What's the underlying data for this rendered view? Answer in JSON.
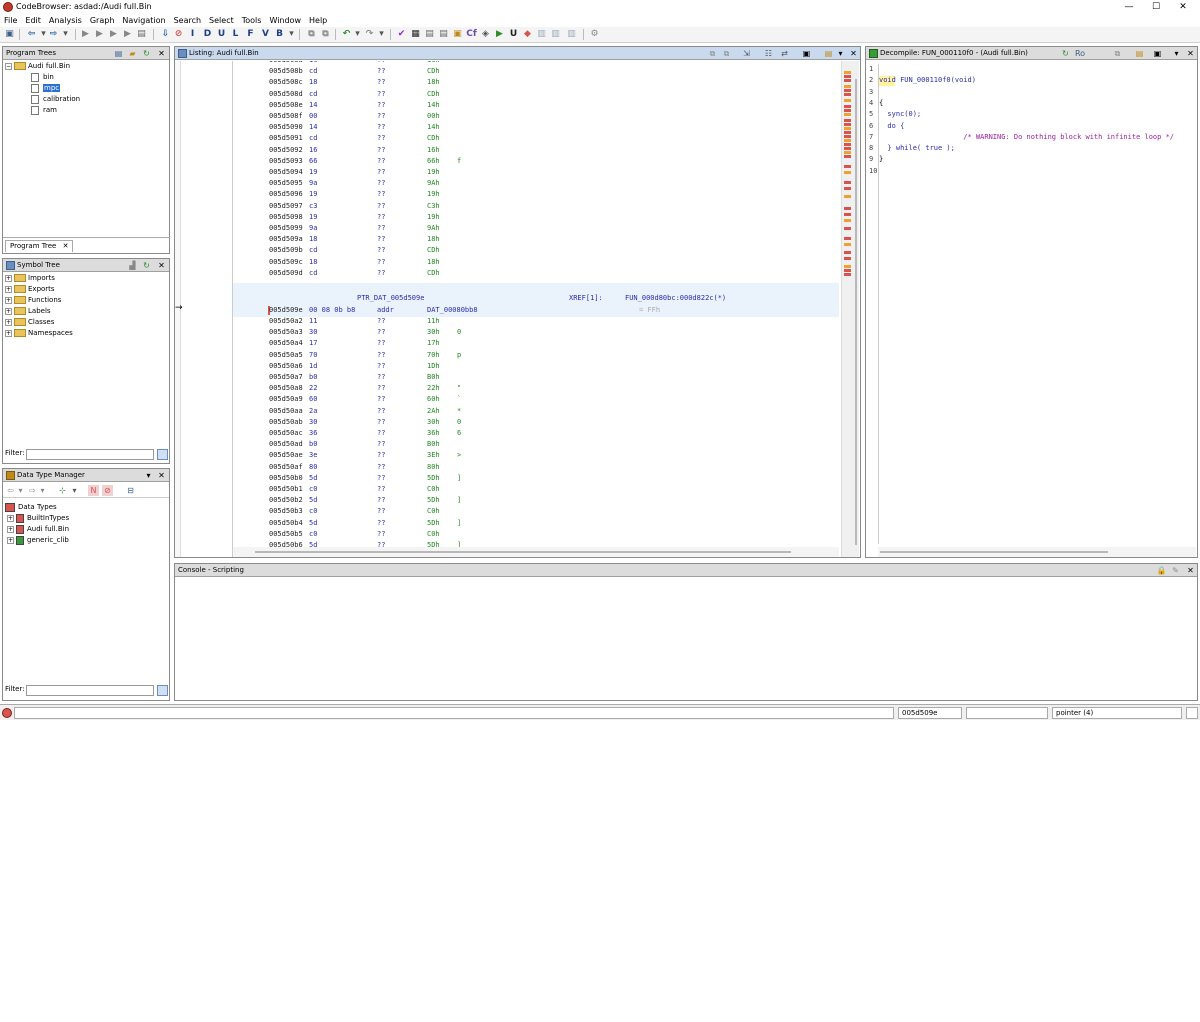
{
  "window": {
    "title": "CodeBrowser: asdad:/Audi full.Bin",
    "minimize": "—",
    "maximize": "☐",
    "close": "✕"
  },
  "menu": [
    "File",
    "Edit",
    "Analysis",
    "Graph",
    "Navigation",
    "Search",
    "Select",
    "Tools",
    "Window",
    "Help"
  ],
  "toolbar_icons": [
    "save-icon",
    "back-icon",
    "forward-icon",
    "nav-data-icon",
    "nav-undefined-icon",
    "nav-label-icon",
    "nav-function-icon",
    "nav-instruction-icon",
    "down-arrow-icon",
    "stop-icon",
    "I",
    "D",
    "U",
    "L",
    "F",
    "V",
    "B",
    "undo-icon",
    "redo-icon",
    "check-icon",
    "hex-icon",
    "clear-icon",
    "camera-icon",
    "cf-icon",
    "play-icon",
    "U2",
    "bookmark-icon",
    "memory-icon",
    "bytes-icon",
    "window-icon",
    "help-icon"
  ],
  "program_trees": {
    "title": "Program Trees",
    "root": "Audi full.Bin",
    "items": [
      "bin",
      "mpc",
      "calibration",
      "ram"
    ],
    "selected": "mpc",
    "tab": "Program Tree",
    "tab_close": "✕"
  },
  "symbol_tree": {
    "title": "Symbol Tree",
    "items": [
      "Imports",
      "Exports",
      "Functions",
      "Labels",
      "Classes",
      "Namespaces"
    ],
    "filter_label": "Filter:"
  },
  "data_type_manager": {
    "title": "Data Type Manager",
    "root": "Data Types",
    "items": [
      "BuiltInTypes",
      "Audi full.Bin",
      "generic_clib"
    ],
    "filter_label": "Filter:"
  },
  "listing": {
    "title": "Listing:  Audi full.Bin",
    "rows_top": [
      {
        "addr": "005d508a",
        "byte": "1c",
        "mnem": "??",
        "oper": "1Ch",
        "chr": ""
      },
      {
        "addr": "005d508b",
        "byte": "cd",
        "mnem": "??",
        "oper": "CDh",
        "chr": ""
      },
      {
        "addr": "005d508c",
        "byte": "18",
        "mnem": "??",
        "oper": "18h",
        "chr": ""
      },
      {
        "addr": "005d508d",
        "byte": "cd",
        "mnem": "??",
        "oper": "CDh",
        "chr": ""
      },
      {
        "addr": "005d508e",
        "byte": "14",
        "mnem": "??",
        "oper": "14h",
        "chr": ""
      },
      {
        "addr": "005d508f",
        "byte": "00",
        "mnem": "??",
        "oper": "00h",
        "chr": ""
      },
      {
        "addr": "005d5090",
        "byte": "14",
        "mnem": "??",
        "oper": "14h",
        "chr": ""
      },
      {
        "addr": "005d5091",
        "byte": "cd",
        "mnem": "??",
        "oper": "CDh",
        "chr": ""
      },
      {
        "addr": "005d5092",
        "byte": "16",
        "mnem": "??",
        "oper": "16h",
        "chr": ""
      },
      {
        "addr": "005d5093",
        "byte": "66",
        "mnem": "??",
        "oper": "66h",
        "chr": "f"
      },
      {
        "addr": "005d5094",
        "byte": "19",
        "mnem": "??",
        "oper": "19h",
        "chr": ""
      },
      {
        "addr": "005d5095",
        "byte": "9a",
        "mnem": "??",
        "oper": "9Ah",
        "chr": ""
      },
      {
        "addr": "005d5096",
        "byte": "19",
        "mnem": "??",
        "oper": "19h",
        "chr": ""
      },
      {
        "addr": "005d5097",
        "byte": "c3",
        "mnem": "??",
        "oper": "C3h",
        "chr": ""
      },
      {
        "addr": "005d5098",
        "byte": "19",
        "mnem": "??",
        "oper": "19h",
        "chr": ""
      },
      {
        "addr": "005d5099",
        "byte": "9a",
        "mnem": "??",
        "oper": "9Ah",
        "chr": ""
      },
      {
        "addr": "005d509a",
        "byte": "18",
        "mnem": "??",
        "oper": "18h",
        "chr": ""
      },
      {
        "addr": "005d509b",
        "byte": "cd",
        "mnem": "??",
        "oper": "CDh",
        "chr": ""
      },
      {
        "addr": "005d509c",
        "byte": "18",
        "mnem": "??",
        "oper": "18h",
        "chr": ""
      },
      {
        "addr": "005d509d",
        "byte": "cd",
        "mnem": "??",
        "oper": "CDh",
        "chr": ""
      }
    ],
    "label": "PTR_DAT_005d509e",
    "xref": "XREF[1]:",
    "xref_target": "FUN_000d80bc:000d822c(*)",
    "ptr_row": {
      "addr": "005d509e",
      "bytes": "00 08 0b b8",
      "mnem": "addr",
      "oper": "DAT_00080bb8",
      "comment": "= FFh"
    },
    "rows_bottom": [
      {
        "addr": "005d50a2",
        "byte": "11",
        "mnem": "??",
        "oper": "11h",
        "chr": ""
      },
      {
        "addr": "005d50a3",
        "byte": "30",
        "mnem": "??",
        "oper": "30h",
        "chr": "0"
      },
      {
        "addr": "005d50a4",
        "byte": "17",
        "mnem": "??",
        "oper": "17h",
        "chr": ""
      },
      {
        "addr": "005d50a5",
        "byte": "70",
        "mnem": "??",
        "oper": "70h",
        "chr": "p"
      },
      {
        "addr": "005d50a6",
        "byte": "1d",
        "mnem": "??",
        "oper": "1Dh",
        "chr": ""
      },
      {
        "addr": "005d50a7",
        "byte": "b0",
        "mnem": "??",
        "oper": "B0h",
        "chr": ""
      },
      {
        "addr": "005d50a8",
        "byte": "22",
        "mnem": "??",
        "oper": "22h",
        "chr": "\""
      },
      {
        "addr": "005d50a9",
        "byte": "60",
        "mnem": "??",
        "oper": "60h",
        "chr": "`"
      },
      {
        "addr": "005d50aa",
        "byte": "2a",
        "mnem": "??",
        "oper": "2Ah",
        "chr": "*"
      },
      {
        "addr": "005d50ab",
        "byte": "30",
        "mnem": "??",
        "oper": "30h",
        "chr": "0"
      },
      {
        "addr": "005d50ac",
        "byte": "36",
        "mnem": "??",
        "oper": "36h",
        "chr": "6"
      },
      {
        "addr": "005d50ad",
        "byte": "b0",
        "mnem": "??",
        "oper": "B0h",
        "chr": ""
      },
      {
        "addr": "005d50ae",
        "byte": "3e",
        "mnem": "??",
        "oper": "3Eh",
        "chr": ">"
      },
      {
        "addr": "005d50af",
        "byte": "80",
        "mnem": "??",
        "oper": "80h",
        "chr": ""
      },
      {
        "addr": "005d50b0",
        "byte": "5d",
        "mnem": "??",
        "oper": "5Dh",
        "chr": "]"
      },
      {
        "addr": "005d50b1",
        "byte": "c0",
        "mnem": "??",
        "oper": "C0h",
        "chr": ""
      },
      {
        "addr": "005d50b2",
        "byte": "5d",
        "mnem": "??",
        "oper": "5Dh",
        "chr": "]"
      },
      {
        "addr": "005d50b3",
        "byte": "c0",
        "mnem": "??",
        "oper": "C0h",
        "chr": ""
      },
      {
        "addr": "005d50b4",
        "byte": "5d",
        "mnem": "??",
        "oper": "5Dh",
        "chr": "]"
      },
      {
        "addr": "005d50b5",
        "byte": "c0",
        "mnem": "??",
        "oper": "C0h",
        "chr": ""
      },
      {
        "addr": "005d50b6",
        "byte": "5d",
        "mnem": "??",
        "oper": "5Dh",
        "chr": "]"
      }
    ]
  },
  "decompile": {
    "title": "Decompile: FUN_000110f0 - (Audi full.Bin)",
    "lines": [
      {
        "n": "1",
        "t": ""
      },
      {
        "n": "2",
        "t": "void FUN_000110f0(void)"
      },
      {
        "n": "3",
        "t": ""
      },
      {
        "n": "4",
        "t": "{"
      },
      {
        "n": "5",
        "t": "  sync(0);"
      },
      {
        "n": "6",
        "t": "  do {"
      },
      {
        "n": "7",
        "t": "                    /* WARNING: Do nothing block with infinite loop */"
      },
      {
        "n": "8",
        "t": "  } while( true );"
      },
      {
        "n": "9",
        "t": "}"
      },
      {
        "n": "10",
        "t": ""
      }
    ]
  },
  "console": {
    "title": "Console - Scripting"
  },
  "status": {
    "address": "005d509e",
    "type": "pointer  (4)"
  },
  "colors": {
    "accent": "#2a6fd1",
    "listing_bg": "#ffffff",
    "header_bg": "#dcdcdc",
    "marker_red": "#d9534f",
    "marker_orange": "#f0a030"
  }
}
